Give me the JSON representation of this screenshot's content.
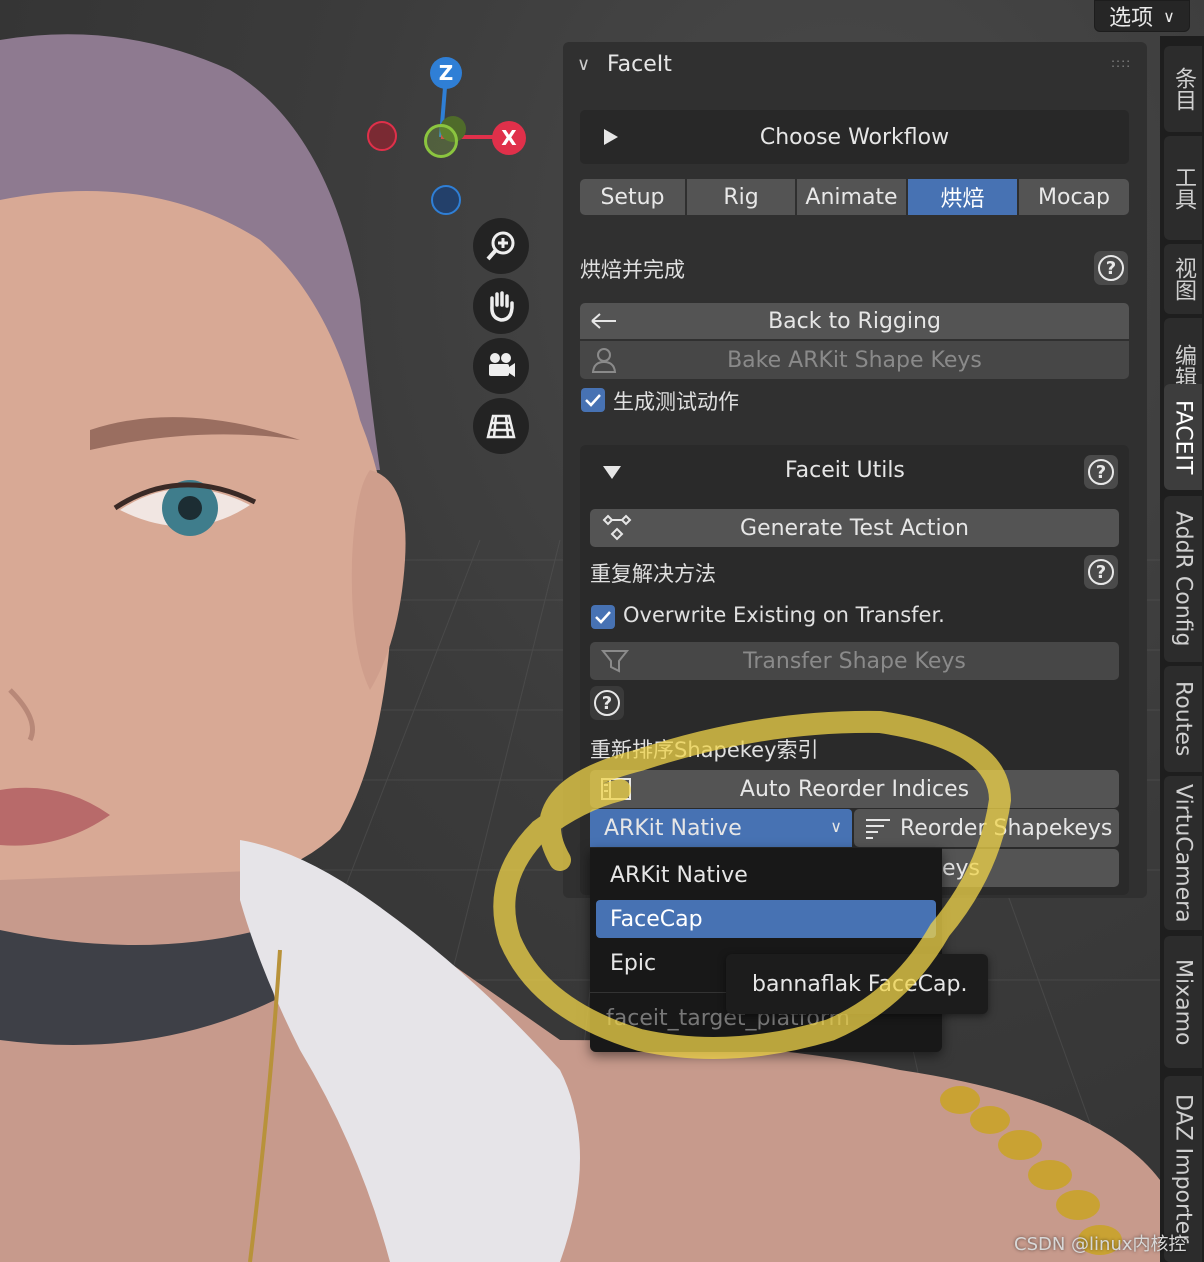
{
  "options_menu": {
    "label": "选项"
  },
  "gizmo": {
    "z": "Z",
    "x": "X",
    "y": "Y"
  },
  "nav_icons": [
    "zoom-icon",
    "hand-pan-icon",
    "camera-icon",
    "grid-icon"
  ],
  "tabs": [
    "条目",
    "工具",
    "视图",
    "编辑",
    "FACEIT",
    "AddR Config",
    "Routes",
    "VirtuCamera",
    "Mixamo",
    "DAZ Importer"
  ],
  "active_tab": "FACEIT",
  "panel": {
    "title": "FaceIt",
    "choose_workflow": "Choose Workflow",
    "workflow_tabs": [
      "Setup",
      "Rig",
      "Animate",
      "烘焙",
      "Mocap"
    ],
    "active_workflow": "烘焙",
    "bake_section_label": "烘焙并完成",
    "back_to_rigging": "Back to Rigging",
    "bake_arkit": "Bake ARKit Shape Keys",
    "generate_test_checkbox": "生成测试动作",
    "utils": {
      "title": "Faceit Utils",
      "generate_test_action": "Generate Test Action",
      "resolve_label": "重复解决方法",
      "overwrite_checkbox": "Overwrite Existing on Transfer.",
      "transfer_shape_keys": "Transfer Shape Keys",
      "reorder_label": "重新排序Shapekey索引",
      "auto_reorder": "Auto Reorder Indices",
      "platform_dropdown_value": "ARKit Native",
      "reorder_shapekeys": "Reorder Shapekeys",
      "hidden_button_tail": "eys"
    }
  },
  "dropdown_menu": {
    "items": [
      "ARKit Native",
      "FaceCap",
      "Epic"
    ],
    "selected": "FaceCap",
    "footer": "faceit_target_platform"
  },
  "tooltip": "bannaflak FaceCap.",
  "watermark": "CSDN @linux内核控",
  "colors": {
    "accent_blue": "#4772b3",
    "panel_bg": "#303030",
    "button_bg": "#545454",
    "annotation_yellow": "#f0d44a",
    "axis_x": "#e0304a",
    "axis_y": "#8bc53f",
    "axis_z": "#2f7fd6"
  }
}
